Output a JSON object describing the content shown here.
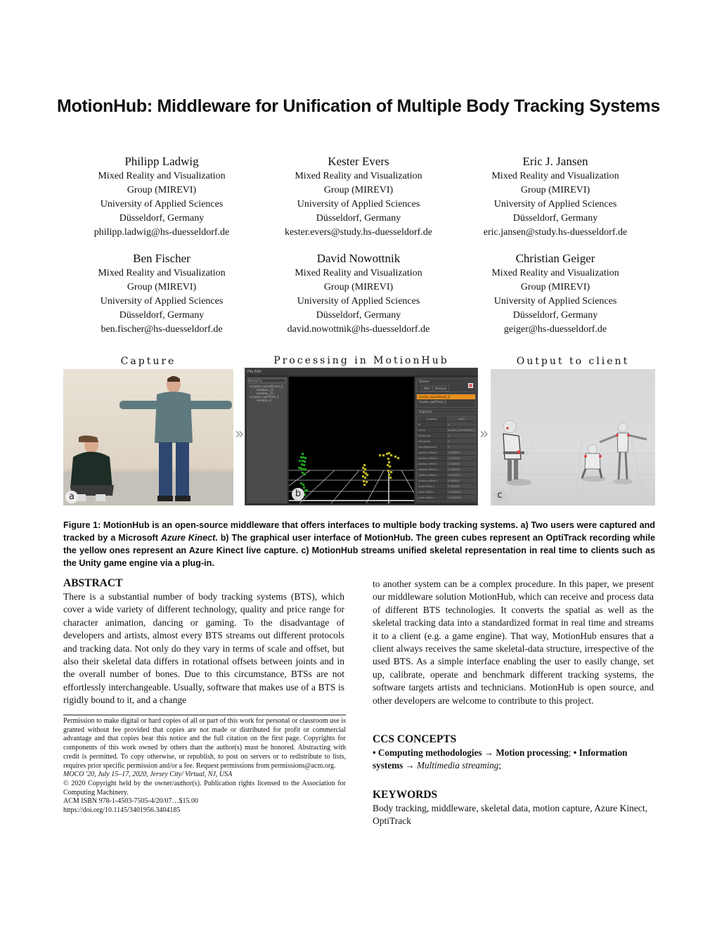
{
  "title": "MotionHub: Middleware for Unification of Multiple Body Tracking Systems",
  "authors": [
    {
      "name": "Philipp Ladwig",
      "affil1": "Mixed Reality and Visualization",
      "affil2": "Group (MIREVI)",
      "affil3": "University of Applied Sciences",
      "location": "Düsseldorf, Germany",
      "email": "philipp.ladwig@hs-duesseldorf.de"
    },
    {
      "name": "Kester Evers",
      "affil1": "Mixed Reality and Visualization",
      "affil2": "Group (MIREVI)",
      "affil3": "University of Applied Sciences",
      "location": "Düsseldorf, Germany",
      "email": "kester.evers@study.hs-duesseldorf.de"
    },
    {
      "name": "Eric J. Jansen",
      "affil1": "Mixed Reality and Visualization",
      "affil2": "Group (MIREVI)",
      "affil3": "University of Applied Sciences",
      "location": "Düsseldorf, Germany",
      "email": "eric.jansen@study.hs-duesseldorf.de"
    },
    {
      "name": "Ben Fischer",
      "affil1": "Mixed Reality and Visualization",
      "affil2": "Group (MIREVI)",
      "affil3": "University of Applied Sciences",
      "location": "Düsseldorf, Germany",
      "email": "ben.fischer@hs-duesseldorf.de"
    },
    {
      "name": "David Nowottnik",
      "affil1": "Mixed Reality and Visualization",
      "affil2": "Group (MIREVI)",
      "affil3": "University of Applied Sciences",
      "location": "Düsseldorf, Germany",
      "email": "david.nowottnik@hs-duesseldorf.de"
    },
    {
      "name": "Christian Geiger",
      "affil1": "Mixed Reality and Visualization",
      "affil2": "Group (MIREVI)",
      "affil3": "University of Applied Sciences",
      "location": "Düsseldorf, Germany",
      "email": "geiger@hs-duesseldorf.de"
    }
  ],
  "figure": {
    "panels": [
      {
        "label": "Capture",
        "badge": "a"
      },
      {
        "label": "Processing in MotionHub",
        "badge": "b"
      },
      {
        "label": "Output to client",
        "badge": "c"
      }
    ],
    "separator": "»",
    "gui": {
      "menu": "File   Edit",
      "hierarchy_header": "Hierarchy",
      "hierarchy_items": [
        "▾ tracker_azureKinect_0",
        "skeleton_14",
        "skeleton_15",
        "▾ tracker_optiTrack_1",
        "skeleton_0"
      ],
      "tracker_header": "Tracker",
      "add_label": "Add",
      "remove_label": "Remove",
      "trackers": [
        "tracker_azureKinect_0",
        "tracker_optiTrack_1"
      ],
      "inspector_header": "Inspector",
      "prop_col": "property",
      "value_col": "value",
      "properties": [
        {
          "k": "id",
          "v": "0"
        },
        {
          "k": "name",
          "v": "tracker_azureKinect_0"
        },
        {
          "k": "isTracking",
          "v": "☐"
        },
        {
          "k": "isEnabled",
          "v": "☑"
        },
        {
          "k": "countDetected",
          "v": "2"
        },
        {
          "k": "position offset x",
          "v": "0.000000"
        },
        {
          "k": "position offset y",
          "v": "1.200000"
        },
        {
          "k": "position offset z",
          "v": "2.300000"
        },
        {
          "k": "rotation offset x",
          "v": "0.000000"
        },
        {
          "k": "rotation offset y",
          "v": "0.000000"
        },
        {
          "k": "rotation offset z",
          "v": "0.000000"
        },
        {
          "k": "scale offset x",
          "v": "0.001000"
        },
        {
          "k": "scale offset y",
          "v": "-0.001000"
        },
        {
          "k": "scale offset z",
          "v": "-0.001000"
        }
      ]
    },
    "colors": {
      "selected_tracker": "#e8901c",
      "optitrack_cubes": "#1f9a1f",
      "kinect_cubes": "#b8b020"
    }
  },
  "caption": "Figure 1: MotionHub is an open-source middleware that offers interfaces to multiple body tracking systems. a) Two users were captured and tracked by a Microsoft ",
  "caption_italic": "Azure Kinect",
  "caption_rest": ". b) The graphical user interface of MotionHub. The green cubes represent an OptiTrack recording while the yellow ones represent an Azure Kinect live capture. c) MotionHub streams unified skeletal representation in real time to clients such as the Unity game engine via a plug-in.",
  "abstract": {
    "heading": "ABSTRACT",
    "left": "There is a substantial number of body tracking systems (BTS), which cover a wide variety of different technology, quality and price range for character animation, dancing or gaming. To the disadvantage of developers and artists, almost every BTS streams out different protocols and tracking data. Not only do they vary in terms of scale and offset, but also their skeletal data differs in rotational offsets between joints and in the overall number of bones. Due to this circumstance, BTSs are not effortlessly interchangeable. Usually, software that makes use of a BTS is rigidly bound to it, and a change",
    "right": "to another system can be a complex procedure. In this paper, we present our middleware solution MotionHub, which can receive and process data of different BTS technologies. It converts the spatial as well as the skeletal tracking data into a standardized format in real time and streams it to a client (e.g. a game engine). That way, MotionHub ensures that a client always receives the same skeletal-data structure, irrespective of the used BTS. As a simple interface enabling the user to easily change, set up, calibrate, operate and benchmark different tracking systems, the software targets artists and technicians. MotionHub is open source, and other developers are welcome to contribute to this project."
  },
  "permission": {
    "text": "Permission to make digital or hard copies of all or part of this work for personal or classroom use is granted without fee provided that copies are not made or distributed for profit or commercial advantage and that copies bear this notice and the full citation on the first page. Copyrights for components of this work owned by others than the author(s) must be honored. Abstracting with credit is permitted. To copy otherwise, or republish, to post on servers or to redistribute to lists, requires prior specific permission and/or a fee. Request permissions from permissions@acm.org.",
    "conference": "MOCO '20, July 15–17, 2020, Jersey City/ Virtual, NJ, USA",
    "copyright": "© 2020 Copyright held by the owner/author(s). Publication rights licensed to the Association for Computing Machinery.",
    "isbn": "ACM ISBN 978-1-4503-7505-4/20/07…$15.00",
    "doi": "https://doi.org/10.1145/3401956.3404185"
  },
  "ccs": {
    "heading": "CCS CONCEPTS",
    "b1": "• Computing methodologies → Motion processing",
    "s1": "; ",
    "b2": "• Information systems → ",
    "i2": "Multimedia streaming",
    "s2": ";"
  },
  "keywords": {
    "heading": "KEYWORDS",
    "text": "Body tracking, middleware, skeletal data, motion capture, Azure Kinect, OptiTrack"
  }
}
